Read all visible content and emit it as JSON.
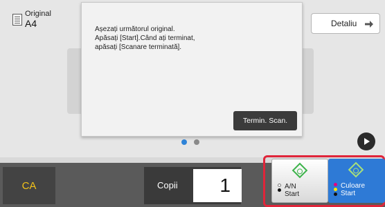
{
  "original": {
    "label": "Original",
    "size": "A4"
  },
  "detail_button": {
    "label": "Detaliu"
  },
  "dialog": {
    "lines": [
      "Așezați următorul original.",
      "Apăsați [Start].Când ați terminat,",
      "apăsați [Scanare terminată]."
    ],
    "finish_button": "Termin. Scan."
  },
  "pager": {
    "pages": 2,
    "current": 1
  },
  "bottom": {
    "ca_label": "CA",
    "copies_label": "Copii",
    "copies_value": "1"
  },
  "start": {
    "bw": {
      "line1": "A/N",
      "line2": "Start"
    },
    "color": {
      "line1": "Culoare",
      "line2": "Start"
    }
  },
  "colors": {
    "highlight": "#e0253a",
    "accent_blue": "#2e7ad6",
    "ca_text": "#f3c21a",
    "start_green": "#3cb34a"
  }
}
